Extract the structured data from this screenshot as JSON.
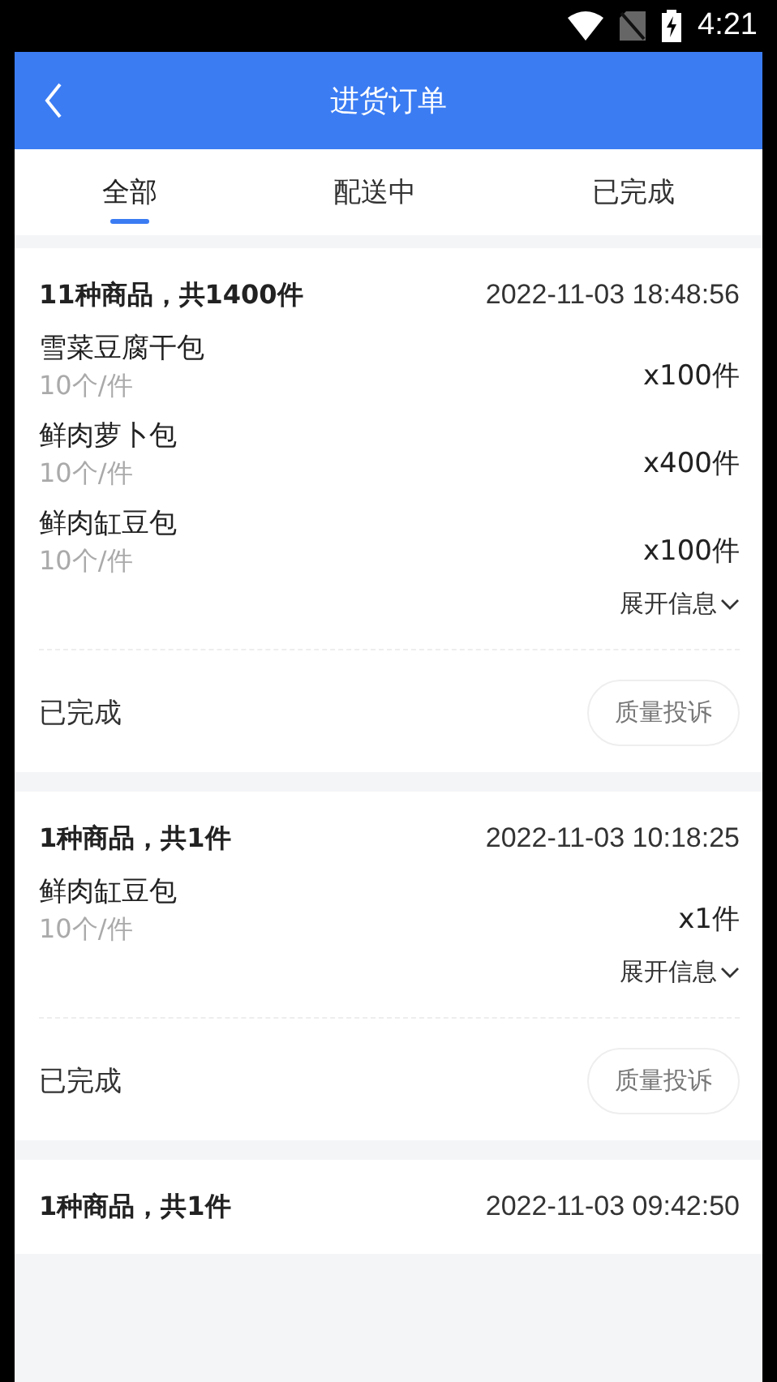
{
  "status_bar": {
    "time": "4:21"
  },
  "header": {
    "title": "进货订单"
  },
  "tabs": [
    {
      "label": "全部",
      "selected": true
    },
    {
      "label": "配送中",
      "selected": false
    },
    {
      "label": "已完成",
      "selected": false
    }
  ],
  "orders": [
    {
      "summary": "11种商品，共1400件",
      "time": "2022-11-03 18:48:56",
      "items": [
        {
          "name": "雪菜豆腐干包",
          "spec": "10个/件",
          "qty": "x100件"
        },
        {
          "name": "鲜肉萝卜包",
          "spec": "10个/件",
          "qty": "x400件"
        },
        {
          "name": "鲜肉缸豆包",
          "spec": "10个/件",
          "qty": "x100件"
        }
      ],
      "expand": "展开信息",
      "status": "已完成",
      "action": "质量投诉"
    },
    {
      "summary": "1种商品，共1件",
      "time": "2022-11-03 10:18:25",
      "items": [
        {
          "name": "鲜肉缸豆包",
          "spec": "10个/件",
          "qty": "x1件"
        }
      ],
      "expand": "展开信息",
      "status": "已完成",
      "action": "质量投诉"
    },
    {
      "summary": "1种商品，共1件",
      "time": "2022-11-03 09:42:50"
    }
  ]
}
